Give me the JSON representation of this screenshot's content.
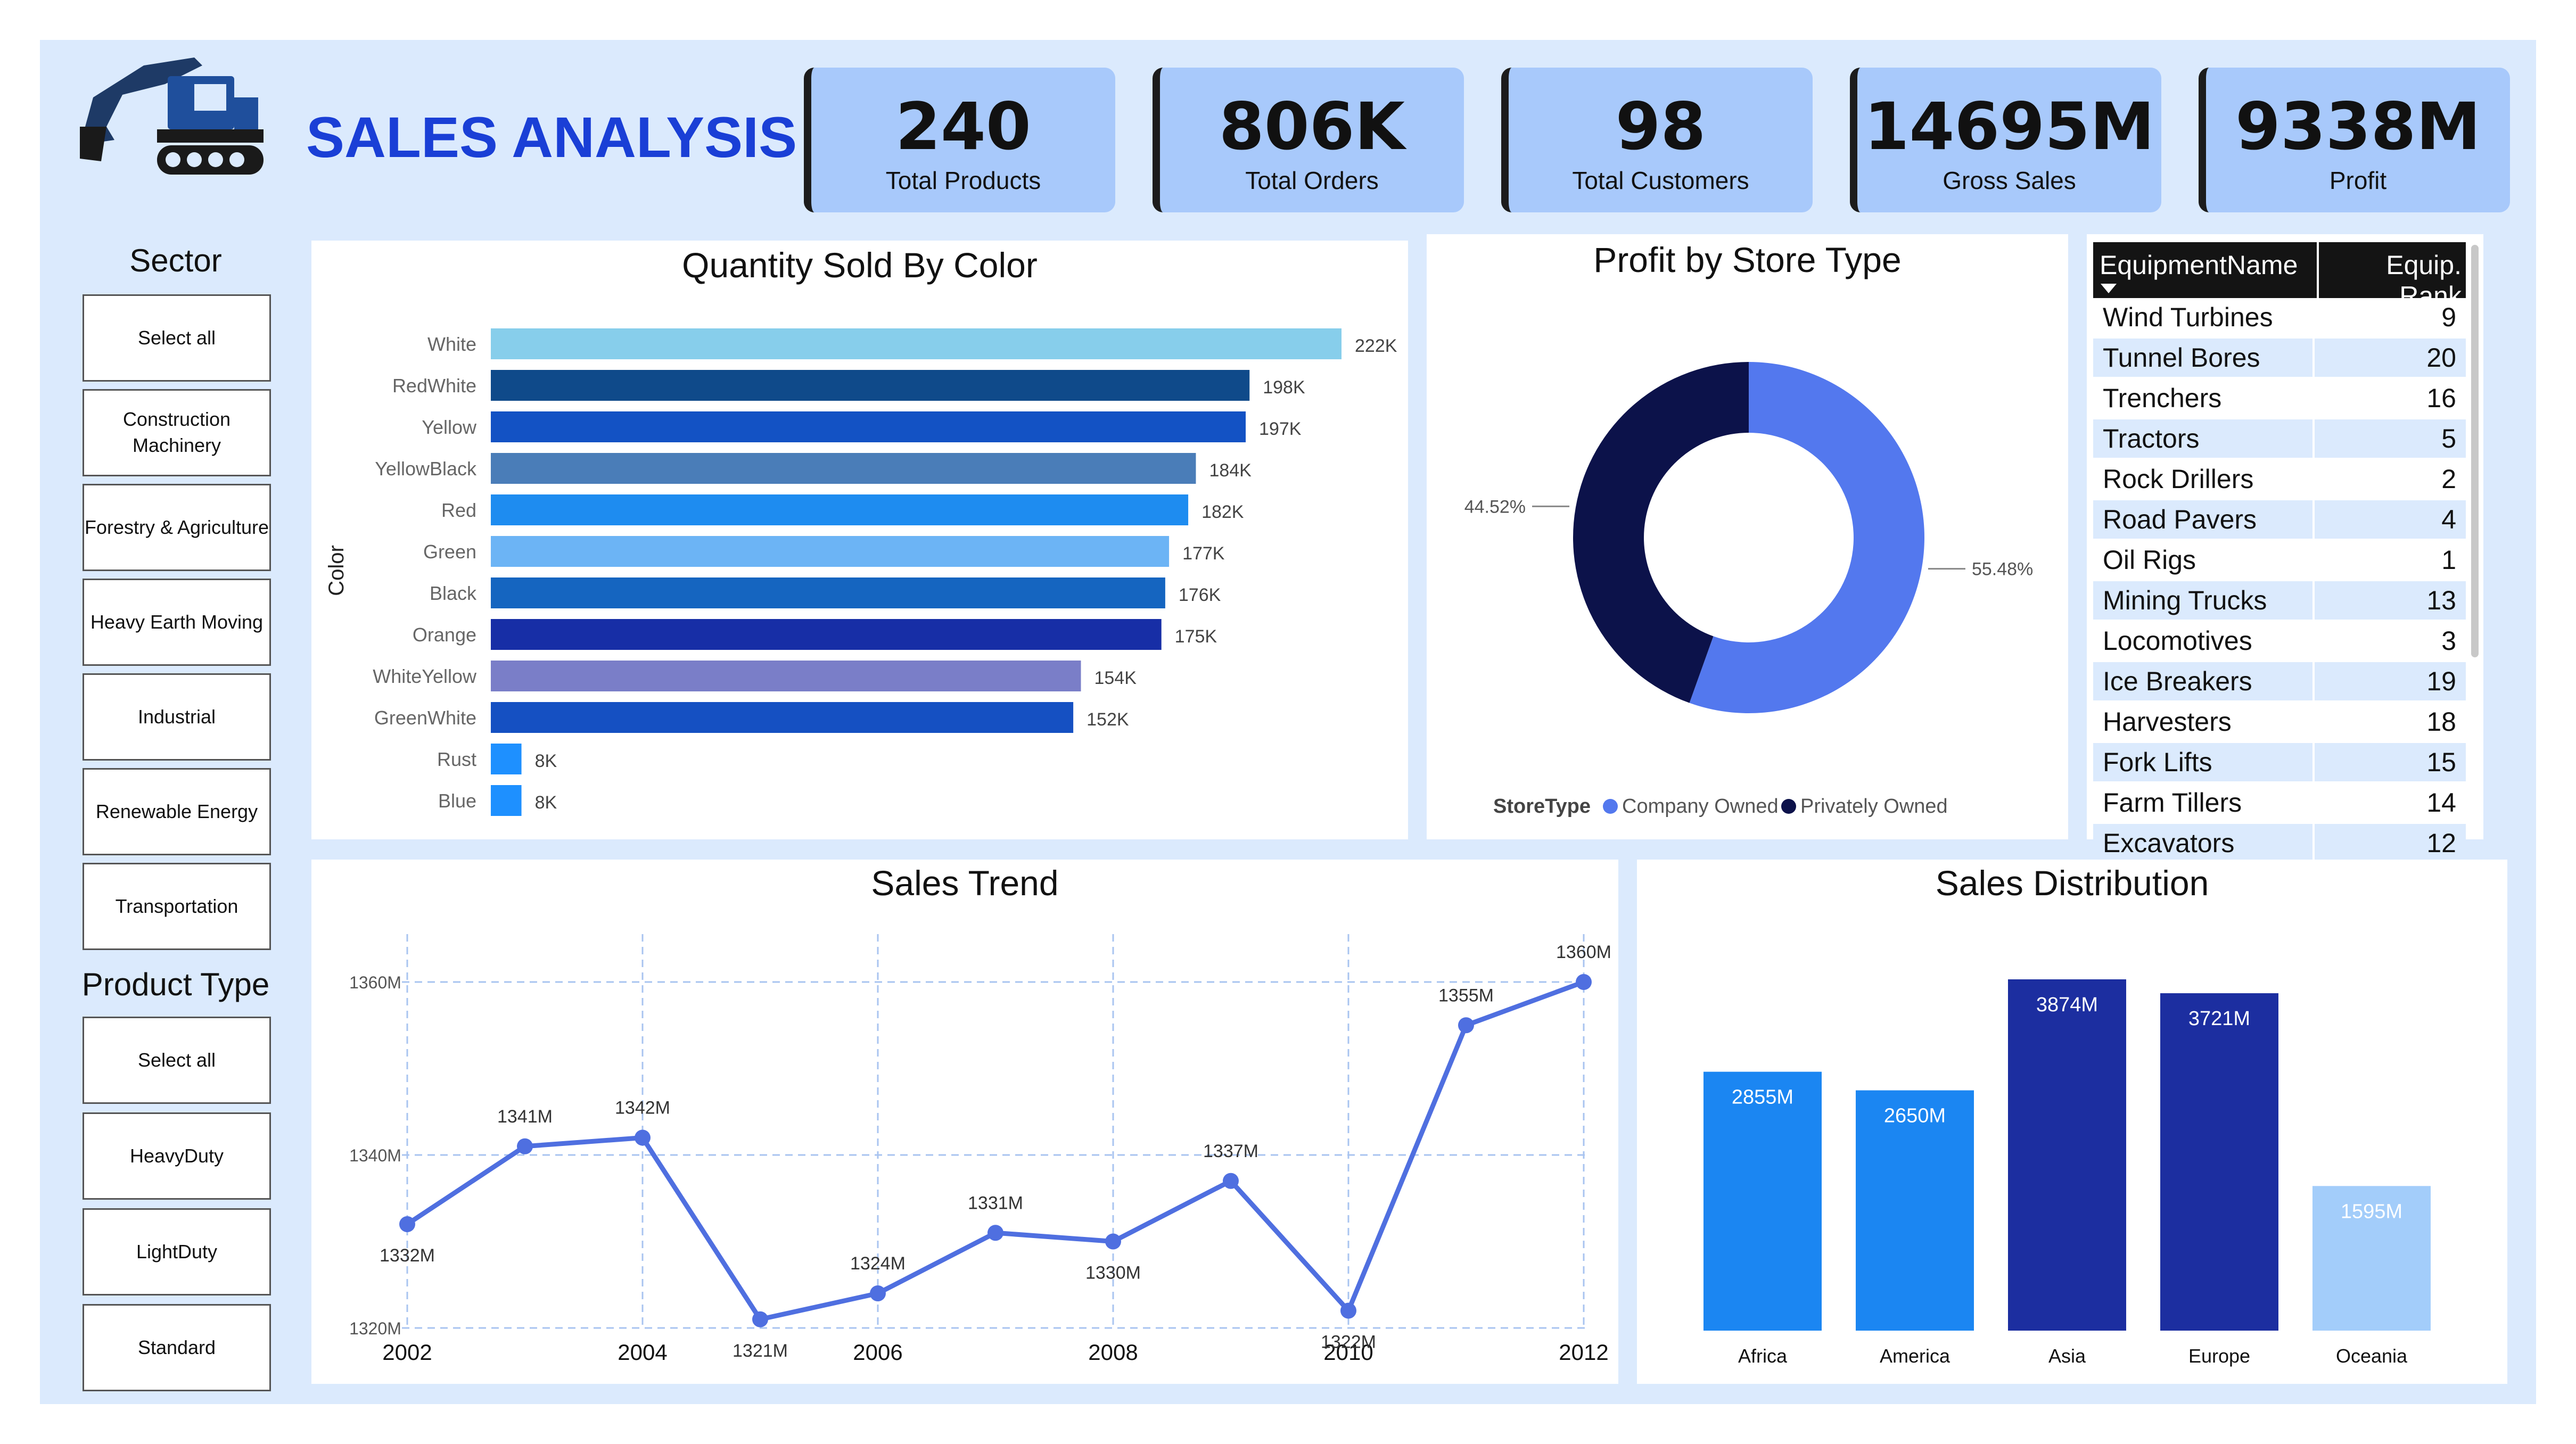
{
  "header": {
    "title": "SALES ANALYSIS",
    "logo_icon": "excavator-icon"
  },
  "kpis": [
    {
      "value": "240",
      "label": "Total Products"
    },
    {
      "value": "806K",
      "label": "Total Orders"
    },
    {
      "value": "98",
      "label": "Total Customers"
    },
    {
      "value": "14695M",
      "label": "Gross Sales"
    },
    {
      "value": "9338M",
      "label": "Profit"
    }
  ],
  "sector": {
    "title": "Sector",
    "items": [
      "Select all",
      "Construction Machinery",
      "Forestry & Agriculture",
      "Heavy Earth Moving",
      "Industrial",
      "Renewable Energy",
      "Transportation"
    ]
  },
  "product_type": {
    "title": "Product Type",
    "items": [
      "Select all",
      "HeavyDuty",
      "LightDuty",
      "Standard"
    ]
  },
  "equipment_table": {
    "headers": [
      "EquipmentName",
      "Equip. Rank"
    ],
    "rows": [
      {
        "name": "Wind Turbines",
        "rank": "9"
      },
      {
        "name": "Tunnel Bores",
        "rank": "20"
      },
      {
        "name": "Trenchers",
        "rank": "16"
      },
      {
        "name": "Tractors",
        "rank": "5"
      },
      {
        "name": "Rock Drillers",
        "rank": "2"
      },
      {
        "name": "Road Pavers",
        "rank": "4"
      },
      {
        "name": "Oil Rigs",
        "rank": "1"
      },
      {
        "name": "Mining Trucks",
        "rank": "13"
      },
      {
        "name": "Locomotives",
        "rank": "3"
      },
      {
        "name": "Ice Breakers",
        "rank": "19"
      },
      {
        "name": "Harvesters",
        "rank": "18"
      },
      {
        "name": "Fork Lifts",
        "rank": "15"
      },
      {
        "name": "Farm Tillers",
        "rank": "14"
      },
      {
        "name": "Excavators",
        "rank": "12"
      }
    ]
  },
  "chart_data": [
    {
      "type": "bar",
      "orientation": "horizontal",
      "title": "Quantity Sold By Color",
      "ylabel": "Color",
      "categories": [
        "White",
        "RedWhite",
        "Yellow",
        "YellowBlack",
        "Red",
        "Green",
        "Black",
        "Orange",
        "WhiteYellow",
        "GreenWhite",
        "Rust",
        "Blue"
      ],
      "values": [
        222000,
        198000,
        197000,
        184000,
        182000,
        177000,
        176000,
        175000,
        154000,
        152000,
        8000,
        8000
      ],
      "data_labels": [
        "222K",
        "198K",
        "197K",
        "184K",
        "182K",
        "177K",
        "176K",
        "175K",
        "154K",
        "152K",
        "8K",
        "8K"
      ],
      "colors": [
        "#87ceeb",
        "#0f4a8a",
        "#1352c4",
        "#4a7db8",
        "#1e8cf0",
        "#6cb4f5",
        "#1565c0",
        "#172ea6",
        "#7a7ec8",
        "#1550c2",
        "#1e90ff",
        "#1e90ff"
      ],
      "xlim": [
        0,
        222000
      ]
    },
    {
      "type": "pie",
      "variant": "donut",
      "title": "Profit by Store Type",
      "legend_title": "StoreType",
      "legend_position": "bottom",
      "slices": [
        {
          "name": "Company Owned",
          "value": 55.48,
          "label": "55.48%",
          "color": "#5378ee"
        },
        {
          "name": "Privately Owned",
          "value": 44.52,
          "label": "44.52%",
          "color": "#0c124a"
        }
      ]
    },
    {
      "type": "line",
      "title": "Sales Trend",
      "x": [
        2002,
        2003,
        2004,
        2005,
        2006,
        2007,
        2008,
        2009,
        2010,
        2011,
        2012
      ],
      "values": [
        1332,
        1341,
        1342,
        1321,
        1324,
        1331,
        1330,
        1337,
        1322,
        1355,
        1360
      ],
      "data_labels": [
        "1332M",
        "1341M",
        "1342M",
        "1321M",
        "1324M",
        "1331M",
        "1330M",
        "1337M",
        "1322M",
        "1355M",
        "1360M"
      ],
      "xticks": [
        "2002",
        "2004",
        "2006",
        "2008",
        "2010",
        "2012"
      ],
      "yticks": [
        "1320M",
        "1340M",
        "1360M"
      ],
      "ylim": [
        1320,
        1360
      ],
      "grid": true,
      "color": "#4f6fe0"
    },
    {
      "type": "bar",
      "title": "Sales Distribution",
      "categories": [
        "Africa",
        "America",
        "Asia",
        "Europe",
        "Oceania"
      ],
      "values": [
        2855,
        2650,
        3874,
        3721,
        1595
      ],
      "data_labels": [
        "2855M",
        "2650M",
        "3874M",
        "3721M",
        "1595M"
      ],
      "colors": [
        "#1b86f2",
        "#1b86f2",
        "#1c2ea0",
        "#1c2ea0",
        "#a3cdfa"
      ],
      "ylim": [
        0,
        3874
      ]
    }
  ]
}
